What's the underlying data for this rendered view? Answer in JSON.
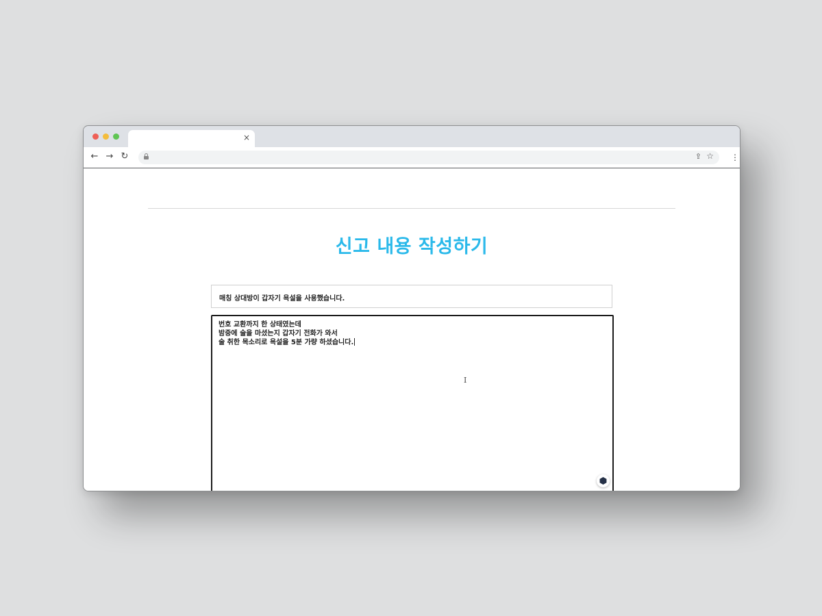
{
  "browser": {
    "tab_title": "",
    "tab_close_icon": "close-icon",
    "url": "",
    "nav_icons": [
      "back-arrow-icon",
      "forward-arrow-icon",
      "reload-icon",
      "lock-icon",
      "share-icon",
      "star-icon",
      "more-menu-icon"
    ]
  },
  "page": {
    "title": "신고 내용 작성하기",
    "title_color": "#2ab9ea"
  },
  "form": {
    "subject": "매칭 상대방이 갑자기 욕설을 사용했습니다.",
    "content_lines": [
      "번호 교환까지 한 상태였는데",
      "밤중에 술을 마셨는지 갑자기 전화가 와서",
      "술 취한 목소리로 욕설을 5분 가량 하셨습니다."
    ],
    "extension_icon": "grammar-assistant-icon"
  }
}
